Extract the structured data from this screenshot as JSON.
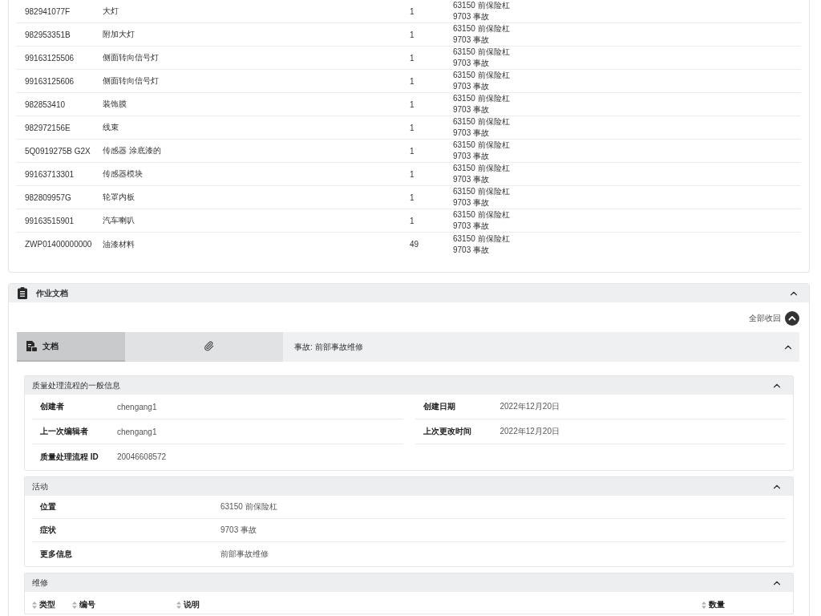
{
  "parts_table": {
    "rows": [
      {
        "part_number": "982941077F",
        "description": "大灯",
        "quantity": "1",
        "location": "63150 前保险杠",
        "symptom": "9703 事故"
      },
      {
        "part_number": "982953351B",
        "description": "附加大灯",
        "quantity": "1",
        "location": "63150 前保险杠",
        "symptom": "9703 事故"
      },
      {
        "part_number": "99163125506",
        "description": "侧面转向信号灯",
        "quantity": "1",
        "location": "63150 前保险杠",
        "symptom": "9703 事故"
      },
      {
        "part_number": "99163125606",
        "description": "侧面转向信号灯",
        "quantity": "1",
        "location": "63150 前保险杠",
        "symptom": "9703 事故"
      },
      {
        "part_number": "982853410",
        "description": "装饰膜",
        "quantity": "1",
        "location": "63150 前保险杠",
        "symptom": "9703 事故"
      },
      {
        "part_number": "982972156E",
        "description": "线束",
        "quantity": "1",
        "location": "63150 前保险杠",
        "symptom": "9703 事故"
      },
      {
        "part_number": "5Q0919275B G2X",
        "description": "传感器 涂底漆的",
        "quantity": "1",
        "location": "63150 前保险杠",
        "symptom": "9703 事故"
      },
      {
        "part_number": "99163713301",
        "description": "传感器模块",
        "quantity": "1",
        "location": "63150 前保险杠",
        "symptom": "9703 事故"
      },
      {
        "part_number": "982809957G",
        "description": "轮罩内板",
        "quantity": "1",
        "location": "63150 前保险杠",
        "symptom": "9703 事故"
      },
      {
        "part_number": "99163515901",
        "description": "汽车喇叭",
        "quantity": "1",
        "location": "63150 前保险杠",
        "symptom": "9703 事故"
      },
      {
        "part_number": "ZWP01400000000",
        "description": "油漆材料",
        "quantity": "49",
        "location": "63150 前保险杠",
        "symptom": "9703 事故"
      }
    ]
  },
  "work_documents": {
    "title": "作业文档",
    "expanded": true,
    "collapse_all": "全部收回",
    "tabs": [
      {
        "kind": "document",
        "label": "文档",
        "selected": true
      },
      {
        "kind": "attachment",
        "selected": false
      }
    ],
    "case_title": "事故: 前部事故维修",
    "case_expanded": true,
    "panels": [
      {
        "kind": "grid",
        "title": "质量处理流程的一般信息",
        "expanded": true,
        "fields": [
          {
            "label": "创建者",
            "value": "chengang1"
          },
          {
            "label": "创建日期",
            "value": "2022年12月20日"
          },
          {
            "label": "上一次编辑者",
            "value": "chengang1"
          },
          {
            "label": "上次更改时间",
            "value": "2022年12月20日"
          },
          {
            "label": "质量处理流程 ID",
            "value": "20046608572"
          }
        ]
      },
      {
        "kind": "list",
        "title": "活动",
        "expanded": true,
        "fields": [
          {
            "label": "位置",
            "value": "63150 前保险杠"
          },
          {
            "label": "症状",
            "value": "9703 事故"
          },
          {
            "label": "更多信息",
            "value": "前部事故维修"
          }
        ]
      },
      {
        "kind": "table",
        "title": "维修",
        "expanded": true,
        "columns": [
          "类型",
          "编号",
          "说明",
          "数量"
        ]
      }
    ]
  }
}
